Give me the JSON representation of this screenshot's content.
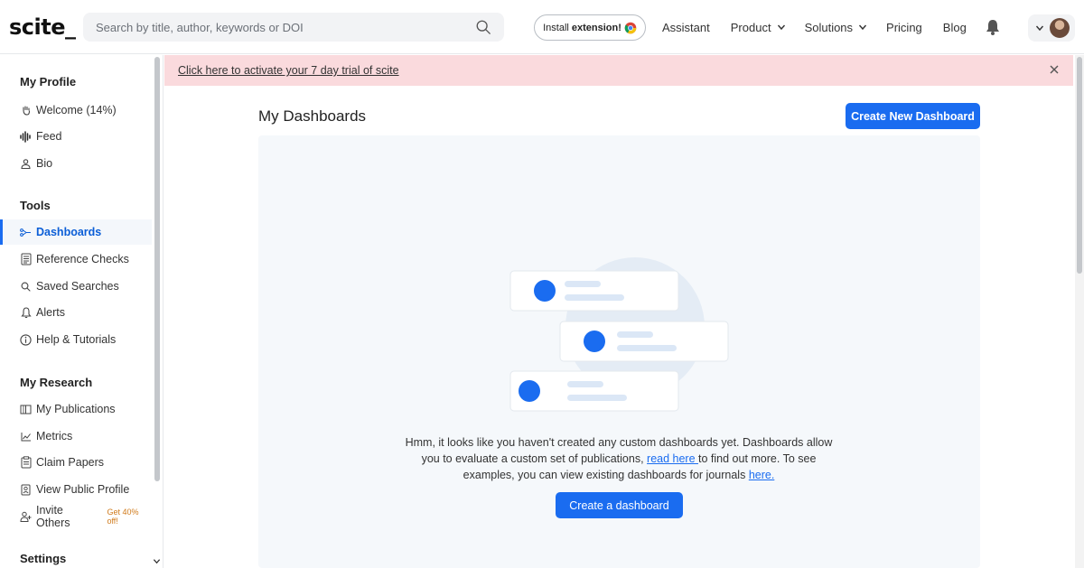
{
  "nav": {
    "logo": "scite_",
    "search_placeholder": "Search by title, author, keywords or DOI",
    "install_extension_prefix": "Install",
    "install_extension_bold": "extension!",
    "links": [
      {
        "label": "Assistant",
        "dropdown": false
      },
      {
        "label": "Product",
        "dropdown": true
      },
      {
        "label": "Solutions",
        "dropdown": true
      },
      {
        "label": "Pricing",
        "dropdown": false
      },
      {
        "label": "Blog",
        "dropdown": false
      }
    ]
  },
  "sidebar": {
    "sections": [
      {
        "title": "My Profile"
      },
      {
        "title": "Tools"
      },
      {
        "title": "My Research"
      },
      {
        "title": "Settings"
      }
    ],
    "items": [
      {
        "label": "Welcome (14%)",
        "icon": "hand-wave-icon"
      },
      {
        "label": "Feed",
        "icon": "feed-wave-icon"
      },
      {
        "label": "Bio",
        "icon": "user-icon"
      },
      {
        "label": "Dashboards",
        "icon": "dashboard-icon",
        "active": true
      },
      {
        "label": "Reference Checks",
        "icon": "document-icon"
      },
      {
        "label": "Saved Searches",
        "icon": "search-icon"
      },
      {
        "label": "Alerts",
        "icon": "bell-icon"
      },
      {
        "label": "Help & Tutorials",
        "icon": "info-icon"
      },
      {
        "label": "My Publications",
        "icon": "book-icon"
      },
      {
        "label": "Metrics",
        "icon": "chart-icon"
      },
      {
        "label": "Claim Papers",
        "icon": "clipboard-icon"
      },
      {
        "label": "View Public Profile",
        "icon": "profile-card-icon"
      },
      {
        "label": "Invite Others",
        "icon": "invite-user-icon",
        "promo": "Get 40% off!"
      }
    ]
  },
  "banner": {
    "text": "Click here to activate your 7 day trial of scite"
  },
  "main": {
    "title": "My Dashboards",
    "create_new_label": "Create New Dashboard",
    "empty_text_1": "Hmm, it looks like you haven't created any custom dashboards yet. Dashboards allow you to evaluate a custom set of publications, ",
    "empty_link_1": "read here ",
    "empty_text_2": "to find out more. To see examples, you can view existing dashboards for journals ",
    "empty_link_2": "here.",
    "create_dashboard_label": "Create a dashboard"
  },
  "colors": {
    "accent": "#1a6cf0",
    "banner": "#fadadd",
    "panel": "#f5f8fb"
  }
}
